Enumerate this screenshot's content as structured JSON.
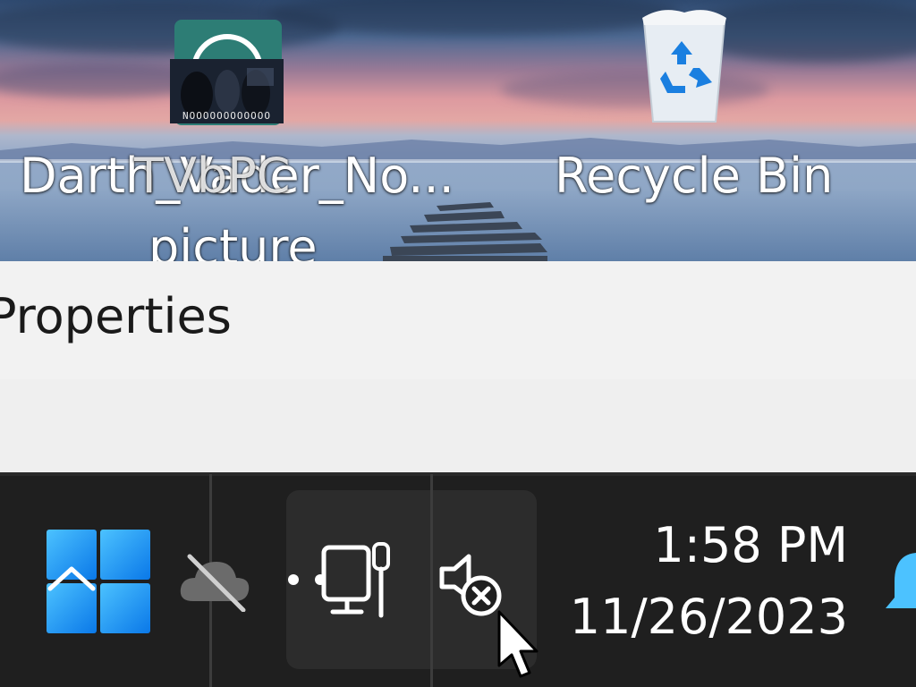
{
  "desktop": {
    "icons": [
      {
        "label_line1": "TVbPC",
        "label_line2": "picture",
        "icon": "app-tile-icon"
      },
      {
        "label": "Darth_Vader_No...",
        "thumbnail_caption": "NOOOOOOOOOOOO",
        "icon": "image-thumbnail"
      },
      {
        "label": "Recycle Bin",
        "icon": "recycle-bin-icon"
      }
    ]
  },
  "context_menu": {
    "item_label": "Properties"
  },
  "taskbar": {
    "tray_icons": [
      "show-hidden-icons-chevron",
      "onedrive-offline-icon",
      "network-disconnected-icon",
      "volume-muted-icon"
    ],
    "clock": {
      "time": "1:58 PM",
      "date": "11/26/2023"
    },
    "notification_icon": "bell-icon"
  },
  "colors": {
    "taskbar_bg": "#1f1f1f",
    "menu_bg": "#f3f3f3",
    "start_blue": "#1e90ff"
  }
}
